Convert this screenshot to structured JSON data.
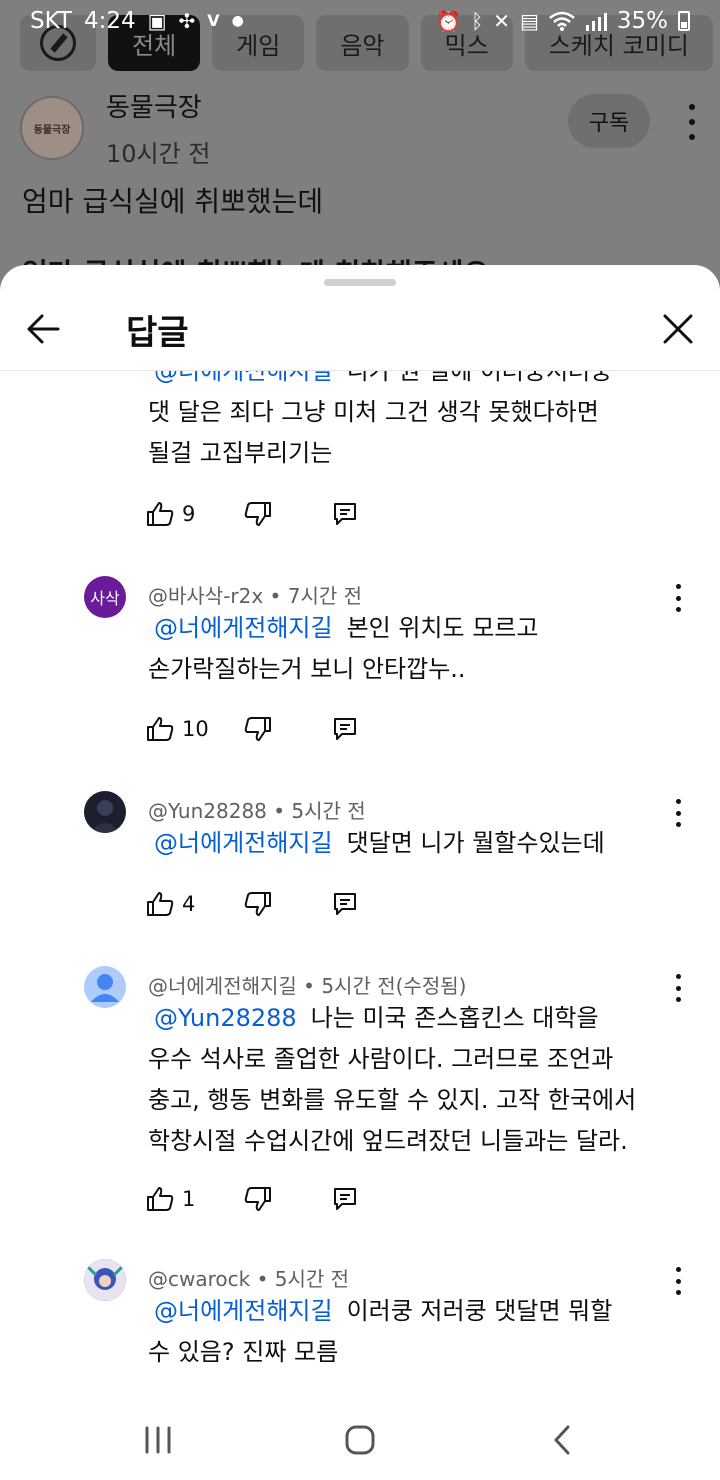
{
  "status_bar": {
    "carrier": "SKT",
    "time": "4:24",
    "battery": "35%"
  },
  "background": {
    "chips": [
      "전체",
      "게임",
      "음악",
      "믹스",
      "스케치 코미디"
    ],
    "channel": {
      "avatar_text": "동물극장",
      "name": "동물극장",
      "time": "10시간 전",
      "subscribe_label": "구독"
    },
    "post_text": "엄마 급식실에 취뽀했는데",
    "post_cut_text": "엄마 급식실에 취뽀했는데 칭찬해주세요"
  },
  "sheet": {
    "title": "답글"
  },
  "comments": [
    {
      "id": "c0",
      "partial": true,
      "mention": "@너에게전해지길",
      "line1_rest": "니가 뭔 일에 이러쿵저러쿵",
      "text_lines": [
        "댓 달은 죄다 그냥 미처 그건 생각 못했다하면",
        "될걸 고집부리기는"
      ],
      "likes": "9"
    },
    {
      "id": "c1",
      "author": "@바사삭-r2x",
      "time": "7시간 전",
      "avatar_text": "사삭",
      "avatar_color": "#6a1b9a",
      "mention": "@너에게전해지길",
      "line1_rest": "본인 위치도 모르고",
      "text_lines": [
        "손가락질하는거 보니 안타깝누.."
      ],
      "likes": "10"
    },
    {
      "id": "c2",
      "author": "@Yun28288",
      "time": "5시간 전",
      "avatar_color": "#1c1f2e",
      "mention": "@너에게전해지길",
      "line1_rest": "댓달면 니가 뭘할수있는데",
      "text_lines": [],
      "likes": "4"
    },
    {
      "id": "c3",
      "author": "@너에게전해지길",
      "time": "5시간 전(수정됨)",
      "avatar_color": "#aecbfa",
      "mention": "@Yun28288",
      "line1_rest": "나는 미국 존스홉킨스 대학을",
      "text_lines": [
        "우수 석사로 졸업한 사람이다. 그러므로 조언과",
        "충고, 행동 변화를 유도할 수 있지. 고작 한국에서",
        "학창시절 수업시간에 엎드려잤던 니들과는 달라."
      ],
      "likes": "1"
    },
    {
      "id": "c4",
      "author": "@cwarock",
      "time": "5시간 전",
      "avatar_color": "#3b3f8f",
      "mention": "@너에게전해지길",
      "line1_rest": "이러쿵 저러쿵 댓달면 뭐할",
      "text_lines": [
        "수 있음? 진짜 모름"
      ]
    }
  ],
  "colors": {
    "mention": "#065fd4",
    "meta": "#606060",
    "dim_overlay": "#7f7f7f"
  }
}
